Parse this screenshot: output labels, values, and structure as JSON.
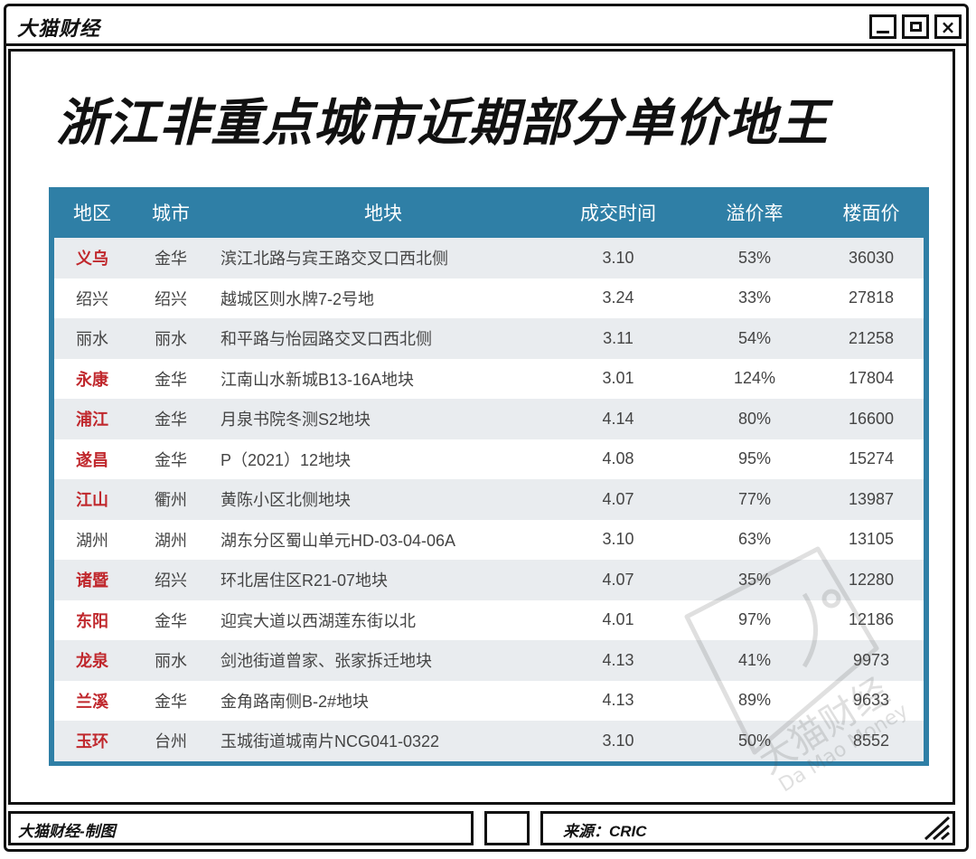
{
  "window": {
    "app_title": "大猫财经"
  },
  "headline": "浙江非重点城市近期部分单价地王",
  "table": {
    "headers": [
      "地区",
      "城市",
      "地块",
      "成交时间",
      "溢价率",
      "楼面价"
    ],
    "rows": [
      {
        "region": "义乌",
        "city": "金华",
        "plot": "滨江北路与宾王路交叉口西北侧",
        "date": "3.10",
        "premium": "53%",
        "price": "36030",
        "highlight": true
      },
      {
        "region": "绍兴",
        "city": "绍兴",
        "plot": "越城区则水牌7-2号地",
        "date": "3.24",
        "premium": "33%",
        "price": "27818",
        "highlight": false
      },
      {
        "region": "丽水",
        "city": "丽水",
        "plot": "和平路与怡园路交叉口西北侧",
        "date": "3.11",
        "premium": "54%",
        "price": "21258",
        "highlight": false
      },
      {
        "region": "永康",
        "city": "金华",
        "plot": "江南山水新城B13-16A地块",
        "date": "3.01",
        "premium": "124%",
        "price": "17804",
        "highlight": true
      },
      {
        "region": "浦江",
        "city": "金华",
        "plot": "月泉书院冬测S2地块",
        "date": "4.14",
        "premium": "80%",
        "price": "16600",
        "highlight": true
      },
      {
        "region": "遂昌",
        "city": "金华",
        "plot": "P（2021）12地块",
        "date": "4.08",
        "premium": "95%",
        "price": "15274",
        "highlight": true
      },
      {
        "region": "江山",
        "city": "衢州",
        "plot": "黄陈小区北侧地块",
        "date": "4.07",
        "premium": "77%",
        "price": "13987",
        "highlight": true
      },
      {
        "region": "湖州",
        "city": "湖州",
        "plot": "湖东分区蜀山单元HD-03-04-06A",
        "date": "3.10",
        "premium": "63%",
        "price": "13105",
        "highlight": false
      },
      {
        "region": "诸暨",
        "city": "绍兴",
        "plot": "环北居住区R21-07地块",
        "date": "4.07",
        "premium": "35%",
        "price": "12280",
        "highlight": true
      },
      {
        "region": "东阳",
        "city": "金华",
        "plot": "迎宾大道以西湖莲东街以北",
        "date": "4.01",
        "premium": "97%",
        "price": "12186",
        "highlight": true
      },
      {
        "region": "龙泉",
        "city": "丽水",
        "plot": "剑池街道曾家、张家拆迁地块",
        "date": "4.13",
        "premium": "41%",
        "price": "9973",
        "highlight": true
      },
      {
        "region": "兰溪",
        "city": "金华",
        "plot": "金角路南侧B-2#地块",
        "date": "4.13",
        "premium": "89%",
        "price": "9633",
        "highlight": true
      },
      {
        "region": "玉环",
        "city": "台州",
        "plot": "玉城街道城南片NCG041-0322",
        "date": "3.10",
        "premium": "50%",
        "price": "8552",
        "highlight": true
      }
    ]
  },
  "watermark": {
    "cn": "大猫财经",
    "en": "Da Mao Money"
  },
  "footer": {
    "left": "大猫财经-制图",
    "right": "来源：CRIC"
  },
  "colors": {
    "header_bg": "#2f7fa6",
    "highlight_text": "#c0282d",
    "row_alt": "#e9ecef"
  }
}
